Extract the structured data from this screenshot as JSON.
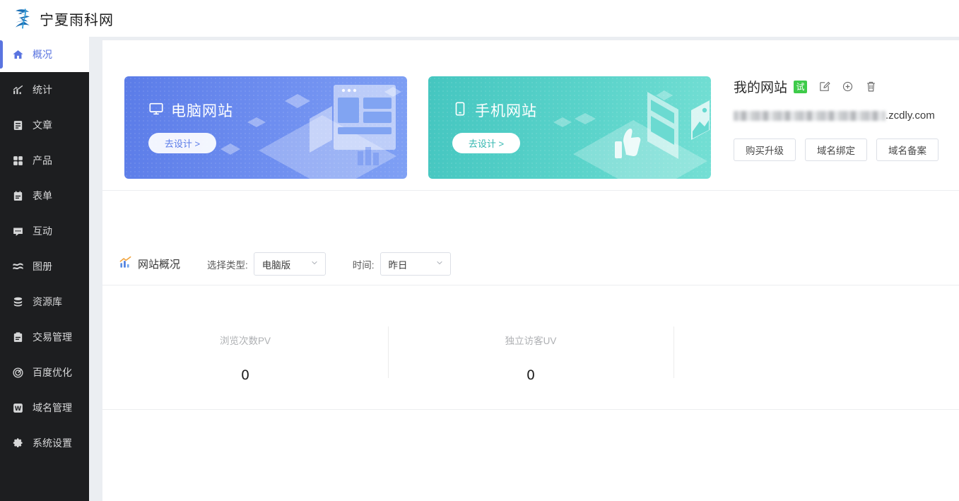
{
  "header": {
    "logo_icon": "brand-logo-icon",
    "brand": "宁夏雨科网"
  },
  "sidebar": {
    "items": [
      {
        "label": "概况",
        "icon": "home-icon",
        "active": true
      },
      {
        "label": "统计",
        "icon": "chart-icon",
        "active": false
      },
      {
        "label": "文章",
        "icon": "article-icon",
        "active": false
      },
      {
        "label": "产品",
        "icon": "grid-icon",
        "active": false
      },
      {
        "label": "表单",
        "icon": "form-icon",
        "active": false
      },
      {
        "label": "互动",
        "icon": "chat-icon",
        "active": false
      },
      {
        "label": "图册",
        "icon": "gallery-icon",
        "active": false
      },
      {
        "label": "资源库",
        "icon": "database-icon",
        "active": false
      },
      {
        "label": "交易管理",
        "icon": "clipboard-icon",
        "active": false
      },
      {
        "label": "百度优化",
        "icon": "target-icon",
        "active": false
      },
      {
        "label": "域名管理",
        "icon": "w-box-icon",
        "active": false
      },
      {
        "label": "系统设置",
        "icon": "gear-icon",
        "active": false
      }
    ]
  },
  "banners": [
    {
      "title": "电脑网站",
      "icon": "desktop-monitor-icon",
      "button": "去设计 >",
      "color": "#5b7ce8"
    },
    {
      "title": "手机网站",
      "icon": "mobile-phone-icon",
      "button": "去设计 >",
      "color": "#45c6c0"
    }
  ],
  "site_info": {
    "name": "我的网站",
    "badge": "试",
    "badge_color": "#3ecb4a",
    "actions": [
      {
        "name": "edit-icon",
        "title": "编辑"
      },
      {
        "name": "add-circle-icon",
        "title": "新增"
      },
      {
        "name": "trash-icon",
        "title": "删除"
      }
    ],
    "url_masked": true,
    "url_suffix": ".zcdly.com",
    "buttons": [
      "购买升级",
      "域名绑定",
      "域名备案"
    ]
  },
  "overview": {
    "title": "网站概况",
    "title_icon": "trend-chart-icon",
    "filters": [
      {
        "label": "选择类型:",
        "value": "电脑版",
        "icon": "chevron-down-icon"
      },
      {
        "label": "时间:",
        "value": "昨日",
        "icon": "chevron-down-icon"
      }
    ]
  },
  "chart_data": {
    "type": "table",
    "title": "网站概况",
    "categories": [
      "浏览次数PV",
      "独立访客UV",
      ""
    ],
    "values": [
      0,
      0,
      null
    ],
    "note": "昨日 / 电脑版"
  }
}
